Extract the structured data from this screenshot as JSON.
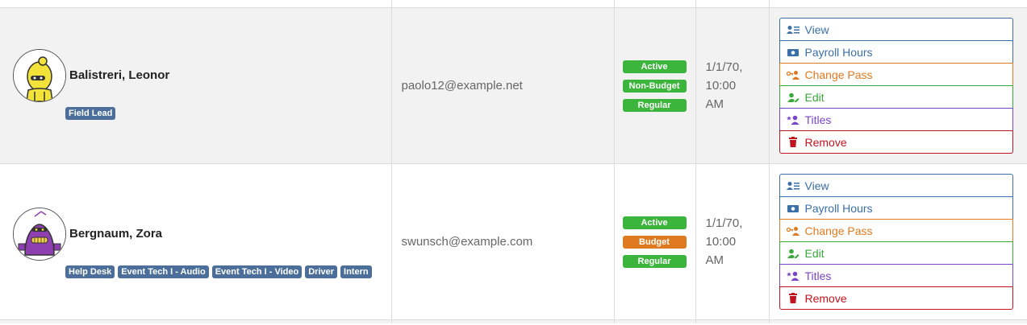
{
  "staff": [
    {
      "name": "Balistreri, Leonor",
      "titles": [
        "Field Lead"
      ],
      "email": "paolo12@example.net",
      "statuses": [
        {
          "label": "Active",
          "color": "#3bb53b"
        },
        {
          "label": "Non-Budget",
          "color": "#3bb53b"
        },
        {
          "label": "Regular",
          "color": "#3bb53b"
        }
      ],
      "date_line1": "1/1/70,",
      "date_line2": "10:00",
      "date_line3": "AM",
      "avatar_color": "#f2e23a"
    },
    {
      "name": "Bergnaum, Zora",
      "titles": [
        "Help Desk",
        "Event Tech I - Audio",
        "Event Tech I - Video",
        "Driver",
        "Intern"
      ],
      "email": "swunsch@example.com",
      "statuses": [
        {
          "label": "Active",
          "color": "#3bb53b"
        },
        {
          "label": "Budget",
          "color": "#e07a20"
        },
        {
          "label": "Regular",
          "color": "#3bb53b"
        }
      ],
      "date_line1": "1/1/70,",
      "date_line2": "10:00",
      "date_line3": "AM",
      "avatar_color": "#8e3fb0"
    }
  ],
  "actions": {
    "view": "View",
    "payroll": "Payroll Hours",
    "change_pass": "Change Pass",
    "edit": "Edit",
    "titles": "Titles",
    "remove": "Remove"
  },
  "icons": {
    "view": "user-list-icon",
    "payroll": "money-bill-icon",
    "change_pass": "user-key-icon",
    "edit": "user-edit-icon",
    "titles": "user-star-icon",
    "remove": "trash-icon"
  },
  "colors": {
    "blue": "#3a6fa8",
    "orange": "#e07a20",
    "green": "#3aa83a",
    "purple": "#7a45c8",
    "red": "#c0141e",
    "tag": "#4b6f9a"
  }
}
